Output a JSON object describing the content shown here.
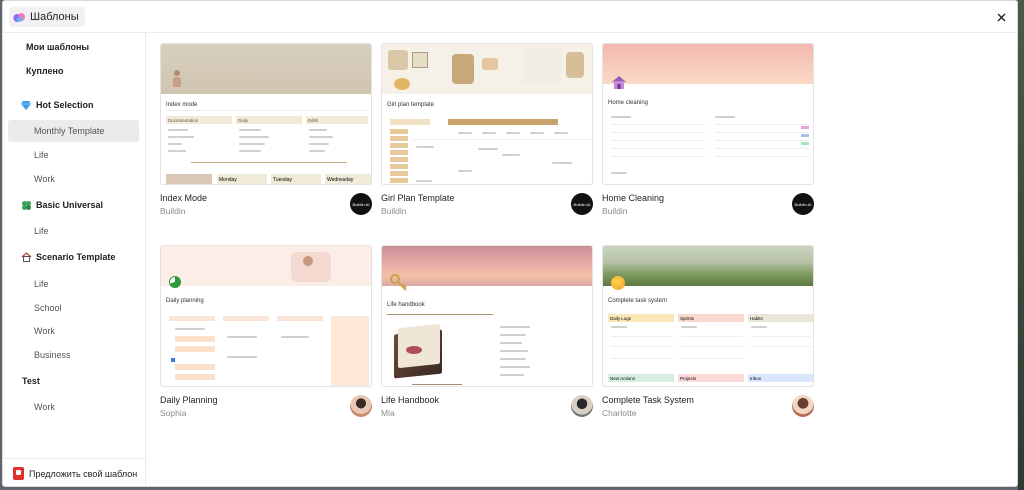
{
  "header": {
    "title": "Шаблоны",
    "close_icon": "close-icon"
  },
  "sidebar": {
    "my_templates": "Мои шаблоны",
    "purchased": "Куплено",
    "hot_selection": "Hot Selection",
    "monthly_template": "Monthly Template",
    "hot_life": "Life",
    "hot_work": "Work",
    "basic_universal": "Basic Universal",
    "basic_life": "Life",
    "scenario_template": "Scenario Template",
    "scenario_life": "Life",
    "scenario_school": "School",
    "scenario_work": "Work",
    "scenario_business": "Business",
    "test": "Test",
    "test_work": "Work",
    "suggest": "Предложить свой шаблон"
  },
  "cards": [
    {
      "name": "Index Mode",
      "author": "Buildin",
      "avatar": "buildin-logo"
    },
    {
      "name": "Girl Plan Template",
      "author": "Buildin",
      "avatar": "buildin-logo"
    },
    {
      "name": "Home Cleaning",
      "author": "Buildin",
      "avatar": "buildin-logo"
    },
    {
      "name": "Daily Planning",
      "author": "Sophia",
      "avatar": "user-photo"
    },
    {
      "name": "Life Handbook",
      "author": "Mia",
      "avatar": "user-photo"
    },
    {
      "name": "Complete Task System",
      "author": "Charlotte",
      "avatar": "user-photo"
    }
  ],
  "thumbs": {
    "index_mode": {
      "title": "Index mode",
      "cols": [
        "Documentation",
        "Daily",
        "Edith"
      ],
      "days": [
        "Monday",
        "Tuesday",
        "Wednesday"
      ]
    },
    "girl_plan": {
      "title": "Girl plan template"
    },
    "home_cleaning": {
      "title": "Home cleaning"
    },
    "daily_planning": {
      "title": "Daily planning"
    },
    "life_handbook": {
      "title": "Life handbook"
    },
    "task_system": {
      "title": "Complete task system",
      "cols": [
        "Daily Logs",
        "Sprints",
        "Habits"
      ],
      "cols2": [
        "Next Actions",
        "Projects",
        "Inbox"
      ]
    }
  },
  "brand_label": "Buildin.AI",
  "colors": {
    "active_bg": "#ebebeb",
    "backdrop": "#5e6670",
    "suggest_icon": "#e0312c"
  }
}
